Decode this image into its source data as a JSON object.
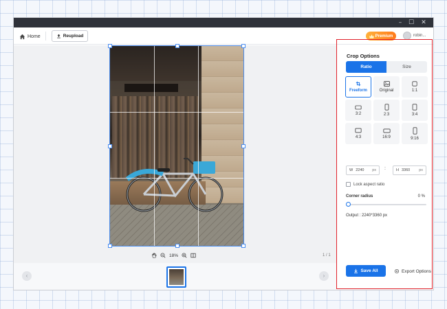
{
  "window": {
    "controls": {
      "minimize": "–",
      "maximize": "☐",
      "close": "✕"
    }
  },
  "toolbar": {
    "home_label": "Home",
    "reupload_label": "Reupload",
    "premium_label": "Premium",
    "user_name": "robin..."
  },
  "canvas": {
    "zoom_level": "18%",
    "page_count": "1 / 1",
    "prev_arrow": "‹",
    "next_arrow": "›"
  },
  "panel": {
    "title": "Crop Options",
    "tabs": [
      {
        "label": "Ratio",
        "active": true
      },
      {
        "label": "Size",
        "active": false
      }
    ],
    "ratios": [
      {
        "label": "Freeform",
        "icon": "crop-icon",
        "selected": true
      },
      {
        "label": "Original",
        "icon": "image-icon",
        "selected": false
      },
      {
        "label": "1:1",
        "icon": "square-icon",
        "selected": false
      },
      {
        "label": "3:2",
        "icon": "landscape-icon",
        "selected": false
      },
      {
        "label": "2:3",
        "icon": "portrait-icon",
        "selected": false
      },
      {
        "label": "3:4",
        "icon": "portrait-icon",
        "selected": false
      },
      {
        "label": "4:3",
        "icon": "landscape-icon",
        "selected": false
      },
      {
        "label": "16:9",
        "icon": "wide-icon",
        "selected": false
      },
      {
        "label": "9:16",
        "icon": "tall-icon",
        "selected": false
      }
    ],
    "width": {
      "prefix": "W",
      "value": "2240",
      "unit": "px"
    },
    "height": {
      "prefix": "H",
      "value": "3360",
      "unit": "px"
    },
    "link_symbol": ":",
    "lock_label": "Lock aspect ratio",
    "lock_checked": false,
    "corner_label": "Corner radius",
    "corner_value": "0 %",
    "corner_level": 0,
    "output_label": "Output :  2240*3360 px",
    "save_label": "Save All",
    "export_label": "Export Options"
  },
  "colors": {
    "accent": "#1a73e8",
    "highlight": "#e0202a",
    "premium": "#ff8a1f"
  }
}
